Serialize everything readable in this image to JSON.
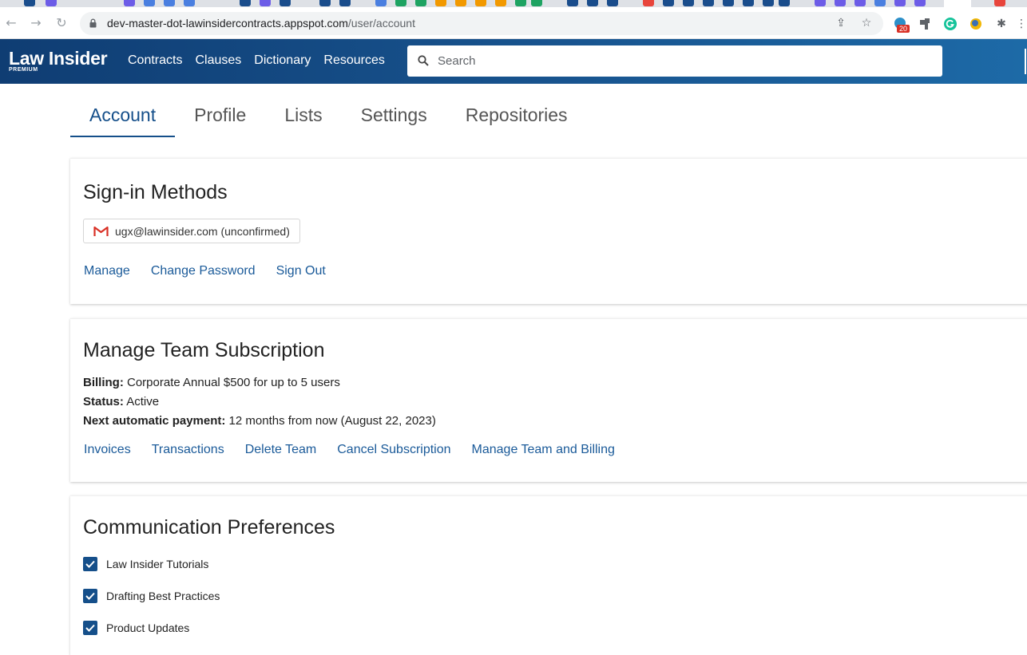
{
  "browser": {
    "url_host": "dev-master-dot-lawinsidercontracts.appspot.com",
    "url_path": "/user/account",
    "extension_badge": "20"
  },
  "header": {
    "logo_name": "Law Insider",
    "logo_tier": "PREMIUM",
    "nav": [
      "Contracts",
      "Clauses",
      "Dictionary",
      "Resources"
    ],
    "search_placeholder": "Search"
  },
  "tabs": [
    "Account",
    "Profile",
    "Lists",
    "Settings",
    "Repositories"
  ],
  "signin": {
    "title": "Sign-in Methods",
    "email": "ugx@lawinsider.com (unconfirmed)",
    "links": [
      "Manage",
      "Change Password",
      "Sign Out"
    ]
  },
  "subscription": {
    "title": "Manage Team Subscription",
    "billing_label": "Billing:",
    "billing_value": "Corporate Annual $500 for up to 5 users",
    "status_label": "Status:",
    "status_value": "Active",
    "next_label": "Next automatic payment:",
    "next_value": "12 months from now (August 22, 2023)",
    "links": [
      "Invoices",
      "Transactions",
      "Delete Team",
      "Cancel Subscription",
      "Manage Team and Billing"
    ]
  },
  "communication": {
    "title": "Communication Preferences",
    "items": [
      "Law Insider Tutorials",
      "Drafting Best Practices",
      "Product Updates"
    ]
  },
  "colors": {
    "brand": "#154f8a",
    "link": "#1a5a99",
    "header_gradient_start": "#0f3d73",
    "header_gradient_end": "#1d6aa7"
  }
}
